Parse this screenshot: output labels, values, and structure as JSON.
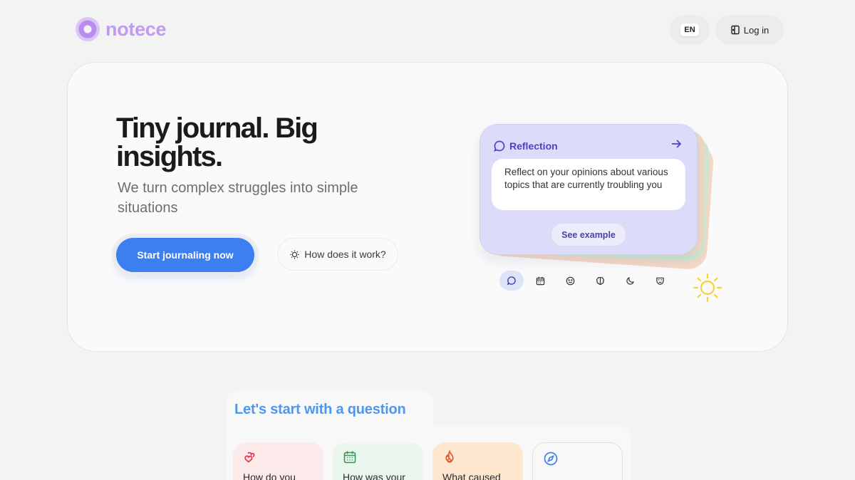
{
  "header": {
    "logo_text": "notece",
    "lang": "EN",
    "login": "Log in"
  },
  "hero": {
    "title": "Tiny journal. Big insights.",
    "subtitle": "We turn complex struggles into simple situations",
    "cta_primary": "Start journaling now",
    "cta_secondary": "How does it work?",
    "prompt": {
      "category": "Reflection",
      "text": "Reflect on your opinions about various topics that are currently troubling you",
      "action": "See example"
    },
    "categories": [
      {
        "icon": "chat-bubble-icon",
        "active": true
      },
      {
        "icon": "calendar-icon",
        "active": false
      },
      {
        "icon": "smiley-icon",
        "active": false
      },
      {
        "icon": "brain-icon",
        "active": false
      },
      {
        "icon": "moon-icon",
        "active": false
      },
      {
        "icon": "mask-icon",
        "active": false
      }
    ]
  },
  "questions": {
    "title": "Let's start with a question",
    "cards": [
      {
        "label": "How do you",
        "icon": "heart-icon",
        "color": "#fdeaea"
      },
      {
        "label": "How was your",
        "icon": "calendar-icon",
        "color": "#eaf7ee"
      },
      {
        "label": "What caused",
        "icon": "flame-icon",
        "color": "#fde7cf"
      },
      {
        "label": "",
        "icon": "compass-icon",
        "color": "#f8f8f8"
      }
    ]
  },
  "colors": {
    "accent": "#3b7ff0",
    "brand": "#c39af2",
    "prompt_bg": "#dcdcfa",
    "question_title": "#4e96ee"
  }
}
